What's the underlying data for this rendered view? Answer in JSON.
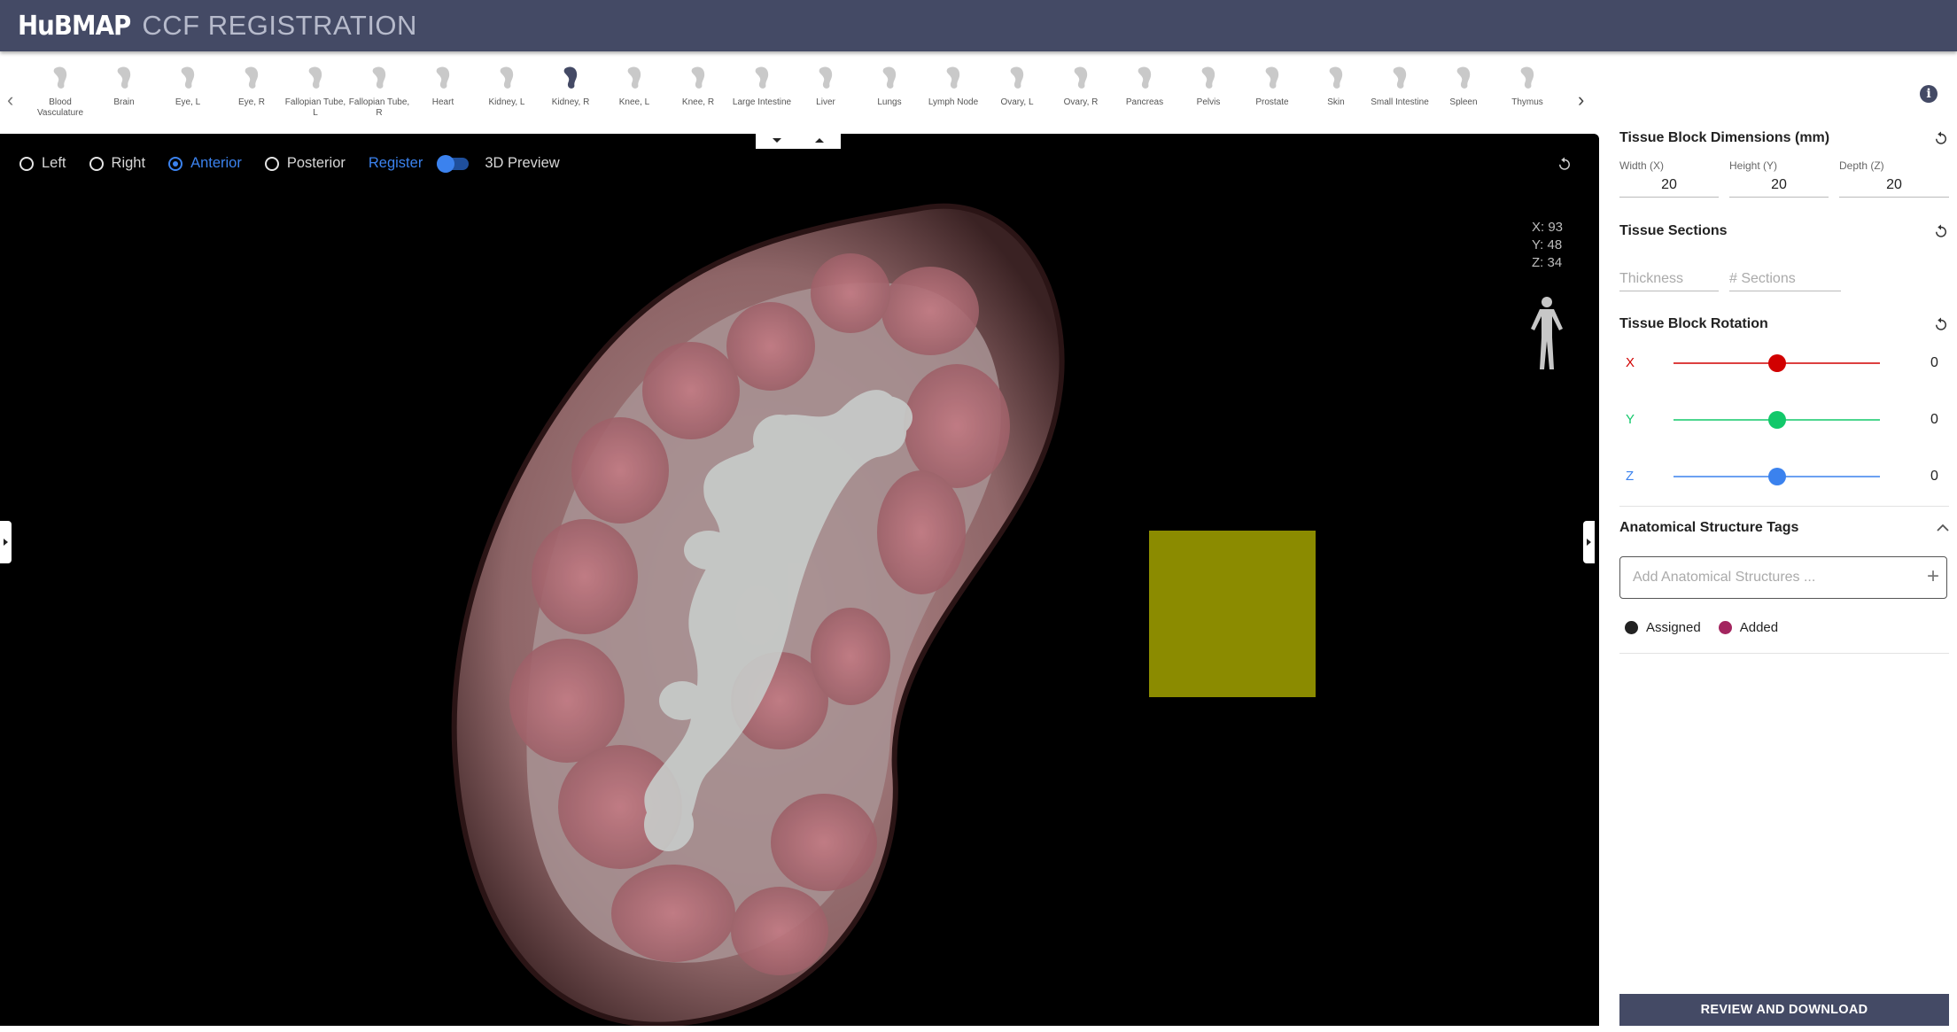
{
  "header": {
    "logo": "HuBMAP",
    "title": "CCF REGISTRATION"
  },
  "organs": [
    {
      "label": "Blood Vasculature",
      "icon": "blood-vasculature-icon"
    },
    {
      "label": "Brain",
      "icon": "brain-icon"
    },
    {
      "label": "Eye, L",
      "icon": "eye-l-icon"
    },
    {
      "label": "Eye, R",
      "icon": "eye-r-icon"
    },
    {
      "label": "Fallopian Tube, L",
      "icon": "fallopian-tube-l-icon"
    },
    {
      "label": "Fallopian Tube, R",
      "icon": "fallopian-tube-r-icon"
    },
    {
      "label": "Heart",
      "icon": "heart-icon"
    },
    {
      "label": "Kidney, L",
      "icon": "kidney-l-icon"
    },
    {
      "label": "Kidney, R",
      "icon": "kidney-r-icon",
      "selected": true
    },
    {
      "label": "Knee, L",
      "icon": "knee-l-icon"
    },
    {
      "label": "Knee, R",
      "icon": "knee-r-icon"
    },
    {
      "label": "Large Intestine",
      "icon": "large-intestine-icon"
    },
    {
      "label": "Liver",
      "icon": "liver-icon"
    },
    {
      "label": "Lungs",
      "icon": "lungs-icon"
    },
    {
      "label": "Lymph Node",
      "icon": "lymph-node-icon"
    },
    {
      "label": "Ovary, L",
      "icon": "ovary-l-icon"
    },
    {
      "label": "Ovary, R",
      "icon": "ovary-r-icon"
    },
    {
      "label": "Pancreas",
      "icon": "pancreas-icon"
    },
    {
      "label": "Pelvis",
      "icon": "pelvis-icon"
    },
    {
      "label": "Prostate",
      "icon": "prostate-icon"
    },
    {
      "label": "Skin",
      "icon": "skin-icon"
    },
    {
      "label": "Small Intestine",
      "icon": "small-intestine-icon"
    },
    {
      "label": "Spleen",
      "icon": "spleen-icon"
    },
    {
      "label": "Thymus",
      "icon": "thymus-icon"
    }
  ],
  "viewer": {
    "views": [
      {
        "label": "Left",
        "selected": false
      },
      {
        "label": "Right",
        "selected": false
      },
      {
        "label": "Anterior",
        "selected": true
      },
      {
        "label": "Posterior",
        "selected": false
      }
    ],
    "register_label": "Register",
    "preview_label": "3D Preview",
    "preview_on": true,
    "coords": {
      "x": "X: 93",
      "y": "Y: 48",
      "z": "Z: 34"
    },
    "tissue_block_color": "#8b8b00"
  },
  "panel": {
    "dimensions": {
      "title": "Tissue Block Dimensions (mm)",
      "width_label": "Width (X)",
      "width_value": "20",
      "height_label": "Height (Y)",
      "height_value": "20",
      "depth_label": "Depth (Z)",
      "depth_value": "20"
    },
    "sections": {
      "title": "Tissue Sections",
      "thickness_placeholder": "Thickness",
      "sections_placeholder": "# Sections"
    },
    "rotation": {
      "title": "Tissue Block Rotation",
      "axes": [
        {
          "label": "X",
          "value": "0",
          "fraction": 0.5,
          "color": "#d10000"
        },
        {
          "label": "Y",
          "value": "0",
          "fraction": 0.5,
          "color": "#12c86a"
        },
        {
          "label": "Z",
          "value": "0",
          "fraction": 0.5,
          "color": "#3b82ee"
        }
      ]
    },
    "tags": {
      "title": "Anatomical Structure Tags",
      "placeholder": "Add Anatomical Structures ...",
      "assigned_label": "Assigned",
      "added_label": "Added",
      "assigned_color": "#222222",
      "added_color": "#a3255f"
    },
    "review_label": "REVIEW AND DOWNLOAD"
  }
}
